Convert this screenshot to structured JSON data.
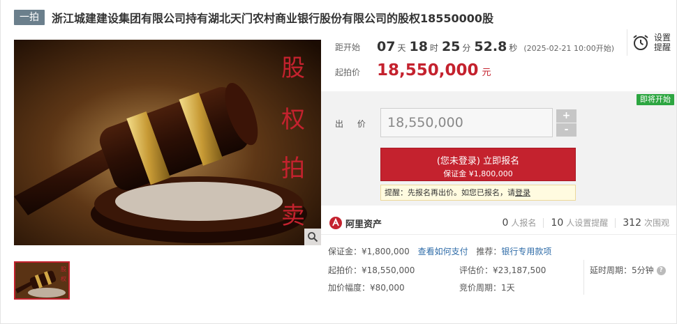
{
  "header": {
    "badge": "一拍",
    "title": "浙江城建建设集团有限公司持有湖北天门农村商业银行股份有限公司的股权18550000股"
  },
  "image": {
    "overlay_chars": [
      "股",
      "权",
      "拍",
      "卖"
    ],
    "thumb_chars": [
      "股",
      "权"
    ]
  },
  "countdown": {
    "label": "距开始",
    "days": "07",
    "days_unit": "天",
    "hours": "18",
    "hours_unit": "时",
    "minutes": "25",
    "minutes_unit": "分",
    "seconds": "52.8",
    "seconds_unit": "秒",
    "start_time": "(2025-02-21 10:00开始)"
  },
  "reminder": {
    "line1": "设置",
    "line2": "提醒"
  },
  "start_price": {
    "label": "起拍价",
    "value": "18,550,000",
    "unit": "元"
  },
  "bid": {
    "status_badge": "即将开始",
    "label": "出 价",
    "value": "18,550,000",
    "plus": "+",
    "minus": "-",
    "signup_main": "(您未登录) 立即报名",
    "signup_sub": "保证金 ¥1,800,000",
    "tip_text": "提醒：先报名再出价。如您已报名，请",
    "tip_link": "登录"
  },
  "platform": {
    "name": "阿里资产"
  },
  "stats": {
    "signups": "0",
    "signups_label": "人报名",
    "reminders": "10",
    "reminders_label": "人设置提醒",
    "views": "312",
    "views_label": "次围观"
  },
  "details": {
    "deposit_label": "保证金：",
    "deposit_value": "¥1,800,000",
    "how_to_pay": "查看如何支付",
    "recommend_label": "推荐：",
    "recommend_link": "银行专用款项",
    "start_label": "起拍价：",
    "start_value": "¥18,550,000",
    "appraisal_label": "评估价：",
    "appraisal_value": "¥23,187,500",
    "delay_label": "延时周期：",
    "delay_value": "5分钟",
    "increment_label": "加价幅度：",
    "increment_value": "¥80,000",
    "cycle_label": "竞价周期：",
    "cycle_value": "1天"
  },
  "colors": {
    "accent": "#c4222e",
    "badge_bg": "#6b7f8c",
    "soon_green": "#2da641",
    "link_blue": "#2f6ca8"
  }
}
